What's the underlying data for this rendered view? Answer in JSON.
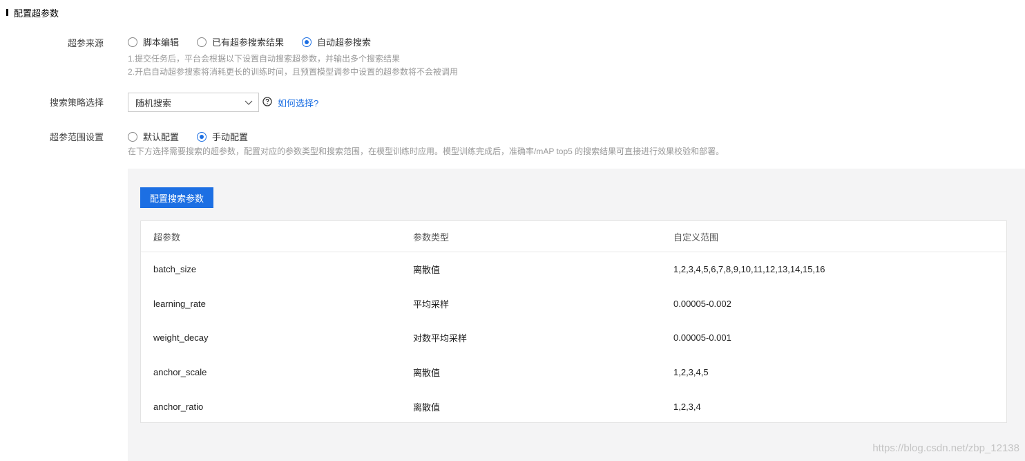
{
  "section": {
    "title": "配置超参数"
  },
  "source": {
    "label": "超参来源",
    "options": [
      {
        "label": "脚本编辑",
        "checked": false
      },
      {
        "label": "已有超参搜索结果",
        "checked": false
      },
      {
        "label": "自动超参搜索",
        "checked": true
      }
    ],
    "hints": [
      "1.提交任务后，平台会根据以下设置自动搜索超参数，并输出多个搜索结果",
      "2.开启自动超参搜索将消耗更长的训练时间，且预置模型调参中设置的超参数将不会被调用"
    ]
  },
  "strategy": {
    "label": "搜索策略选择",
    "selected": "随机搜索",
    "help_icon": "question-circle-icon",
    "help_link": "如何选择?"
  },
  "range": {
    "label": "超参范围设置",
    "options": [
      {
        "label": "默认配置",
        "checked": false
      },
      {
        "label": "手动配置",
        "checked": true
      }
    ],
    "hint": "在下方选择需要搜索的超参数，配置对应的参数类型和搜索范围，在模型训练时应用。模型训练完成后，准确率/mAP top5 的搜索结果可直接进行效果校验和部署。"
  },
  "config_button": "配置搜索参数",
  "table": {
    "headers": [
      "超参数",
      "参数类型",
      "自定义范围"
    ],
    "rows": [
      [
        "batch_size",
        "离散值",
        "1,2,3,4,5,6,7,8,9,10,11,12,13,14,15,16"
      ],
      [
        "learning_rate",
        "平均采样",
        "0.00005-0.002"
      ],
      [
        "weight_decay",
        "对数平均采样",
        "0.00005-0.001"
      ],
      [
        "anchor_scale",
        "离散值",
        "1,2,3,4,5"
      ],
      [
        "anchor_ratio",
        "离散值",
        "1,2,3,4"
      ]
    ]
  },
  "watermark": "https://blog.csdn.net/zbp_12138",
  "colors": {
    "accent": "#1c6fe3",
    "panel_bg": "#f4f4f5",
    "hint": "#999999"
  }
}
